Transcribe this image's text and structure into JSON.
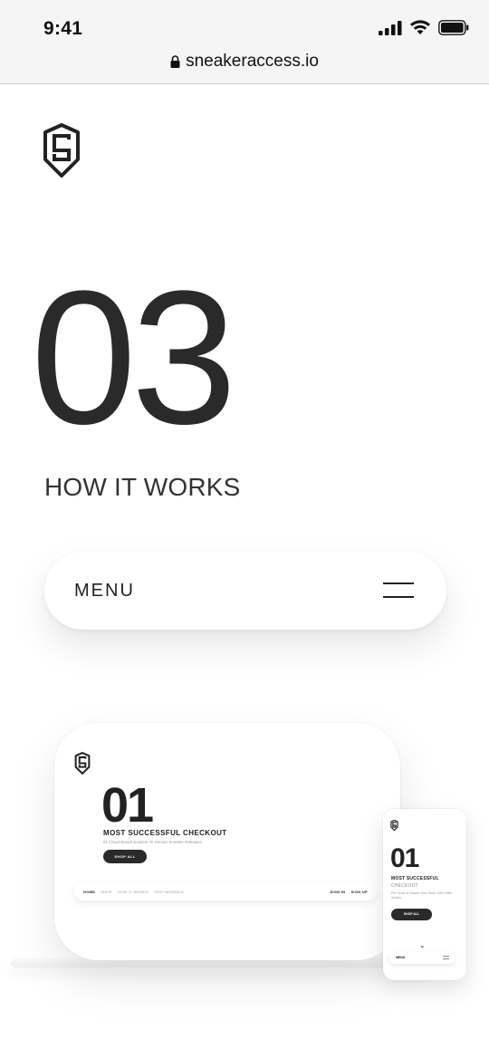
{
  "status_bar": {
    "time": "9:41"
  },
  "browser": {
    "url": "sneakeraccess.io"
  },
  "section": {
    "number": "03",
    "title": "HOW IT WORKS"
  },
  "menu": {
    "label": "MENU"
  },
  "desktop_preview": {
    "number": "01",
    "heading": "MOST SUCCESSFUL CHECKOUT",
    "subtitle": "#1 Cloud Based Solution To Secure Sneaker Releases",
    "button": "SHOP ALL",
    "nav": [
      "HOME",
      "SHOP",
      "HOW IT WORKS",
      "TESTIMONIALS"
    ],
    "sign_in": "SIGN IN",
    "sign_up": "SIGN UP"
  },
  "mobile_preview": {
    "number": "01",
    "heading": "MOST SUCCESSFUL",
    "heading2": "CHECKOUT",
    "subtitle": "Pre Order & Secure Your Steal 100% With Snaker",
    "button": "SHOP ALL",
    "chevron": "⌄",
    "menu": "MENU"
  },
  "colors": {
    "text": "#222222",
    "button": "#2a2a2a",
    "background": "#ffffff"
  }
}
